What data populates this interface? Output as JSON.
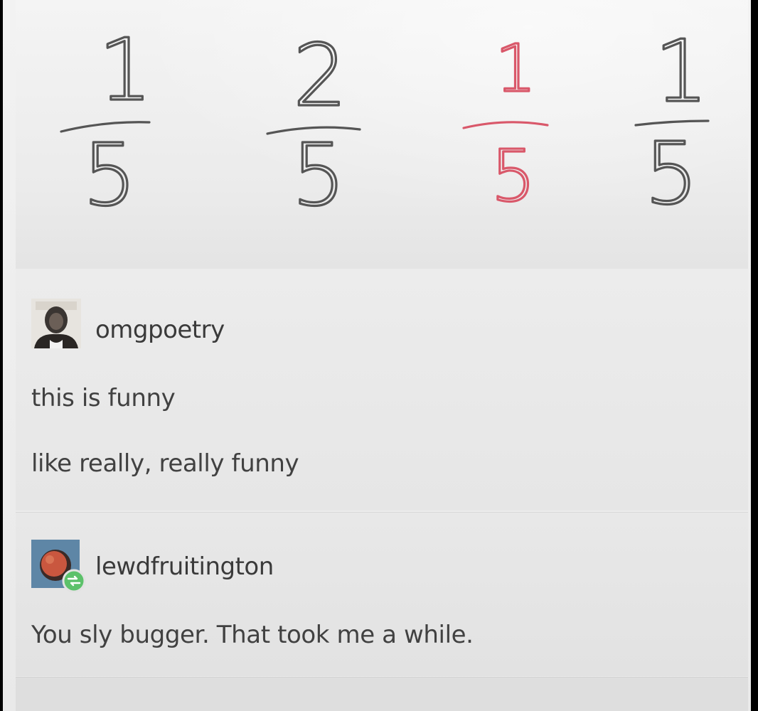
{
  "photo": {
    "fractions": [
      {
        "numerator": "1",
        "denominator": "5",
        "ink": "#555555"
      },
      {
        "numerator": "2",
        "denominator": "5",
        "ink": "#555555"
      },
      {
        "numerator": "1",
        "denominator": "5",
        "ink": "#d9586a"
      },
      {
        "numerator": "1",
        "denominator": "5",
        "ink": "#555555"
      }
    ]
  },
  "post": {
    "username": "omgpoetry",
    "avatar_icon": "person-avatar-icon",
    "lines": [
      "this is funny",
      "like really, really funny"
    ]
  },
  "reply": {
    "username": "lewdfruitington",
    "avatar_icon": "fruit-avatar-icon",
    "reblog_badge_icon": "reblog-icon",
    "text": "You sly bugger. That took me a while."
  },
  "colors": {
    "ink_dark": "#555555",
    "ink_red": "#d9586a",
    "text": "#414141",
    "badge_green": "#5cc16a"
  }
}
